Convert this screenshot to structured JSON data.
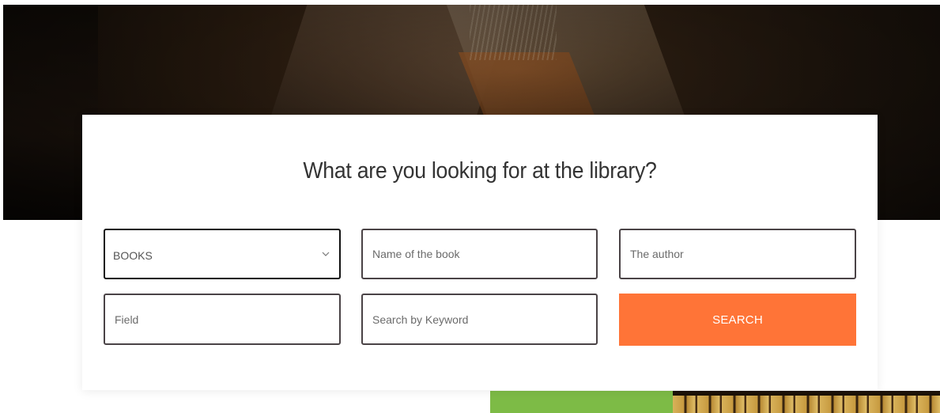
{
  "search_form": {
    "title": "What are you looking for at the library?",
    "category_select": {
      "selected": "BOOKS"
    },
    "book_name_field": {
      "placeholder": "Name of the book"
    },
    "author_field": {
      "placeholder": "The author"
    },
    "field_field": {
      "placeholder": "Field"
    },
    "keyword_field": {
      "placeholder": "Search by Keyword"
    },
    "search_button_label": "SEARCH",
    "icons": {
      "select_arrow": "chevron-down-icon"
    }
  },
  "colors": {
    "accent_button": "#ff7437",
    "green_block": "#7dbb46",
    "field_border": "#4a4346",
    "title_text": "#333333"
  }
}
